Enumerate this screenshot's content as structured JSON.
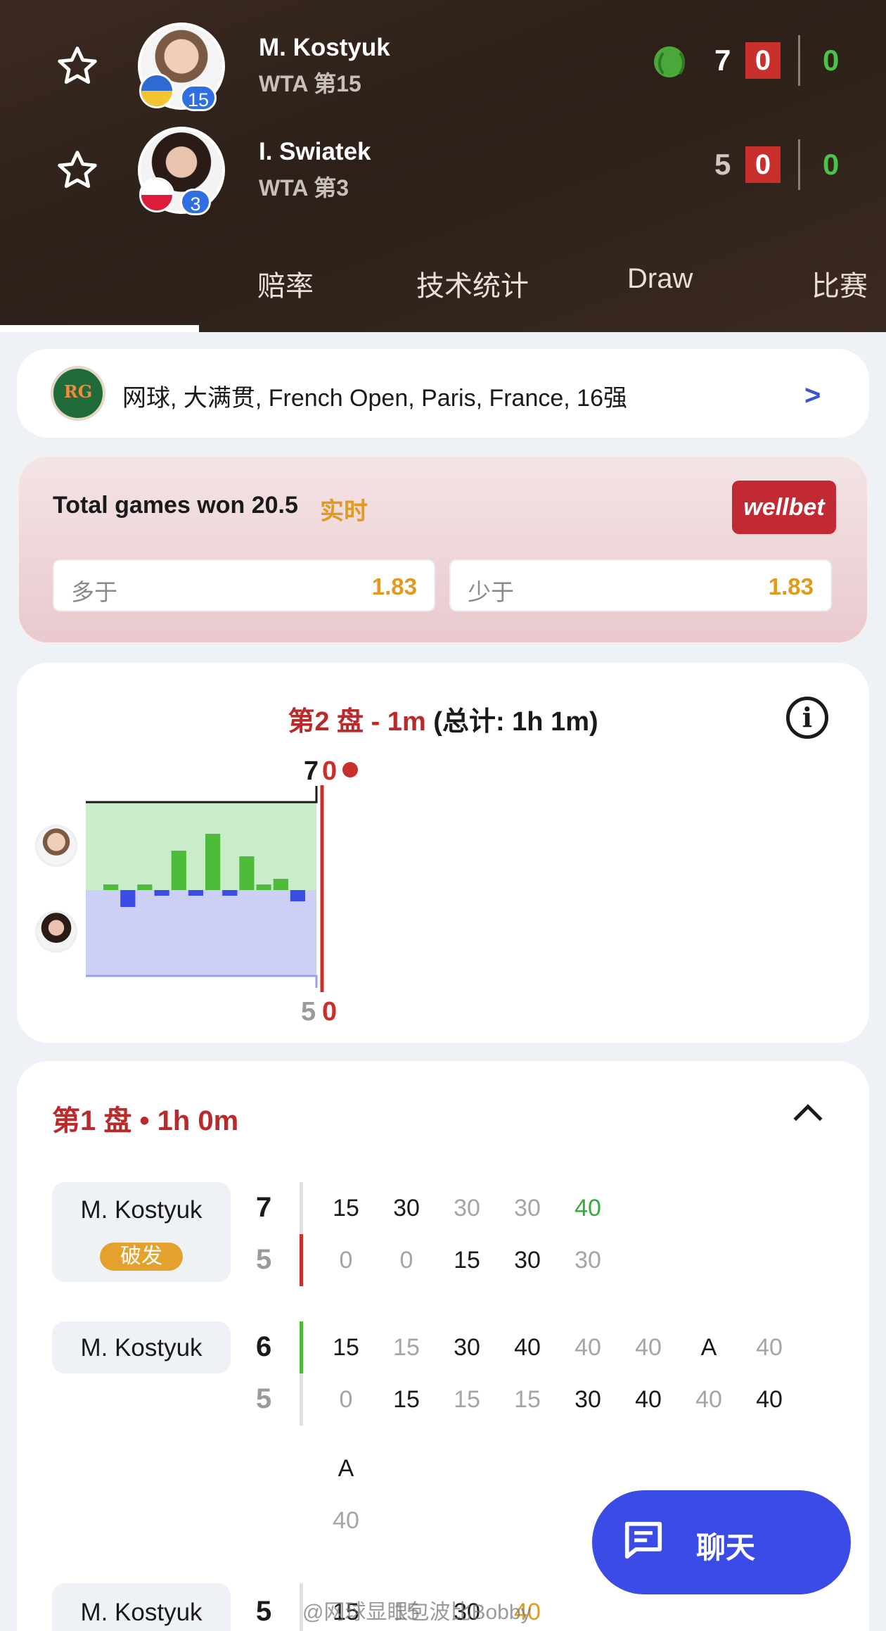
{
  "header": {
    "players": [
      {
        "name": "M. Kostyuk",
        "rank_text": "WTA 第15",
        "seed": "15",
        "set1": "7",
        "current_set": "0",
        "point": "0",
        "flag": [
          "#2e6ad1",
          "#f4c531"
        ],
        "serving": true
      },
      {
        "name": "I. Swiatek",
        "rank_text": "WTA 第3",
        "seed": "3",
        "set1": "5",
        "current_set": "0",
        "point": "0",
        "flag": [
          "#ffffff",
          "#dc1c3a"
        ],
        "serving": false
      }
    ],
    "tabs": [
      "赔率",
      "技术统计",
      "Draw",
      "比赛"
    ]
  },
  "tournament": {
    "text": "网球, 大满贯, French Open, Paris, France, 16强"
  },
  "betting": {
    "market": "Total games won 20.5",
    "live_label": "实时",
    "bookmaker": "wellbet",
    "over_label": "多于",
    "over_odds": "1.83",
    "under_label": "少于",
    "under_odds": "1.83"
  },
  "momentum": {
    "title_red": "第2 盘 - 1m",
    "title_rest": "(总计: 1h 1m)",
    "top_score": "7",
    "top_current": "0",
    "bottom_score": "5",
    "bottom_current": "0",
    "bars": [
      1,
      -3,
      1,
      -1,
      7,
      -1,
      10,
      -1,
      6,
      1,
      2,
      -2
    ],
    "colors": {
      "kostyuk": "#4dbb3a",
      "swiatek": "#3a4be6",
      "current": "#c9302c"
    }
  },
  "set1": {
    "title": "第1 盘 • 1h 0m",
    "games": [
      {
        "server": "M. Kostyuk",
        "badge": "破发",
        "top_score": "7",
        "bottom_score": "5",
        "top": [
          "15",
          "30",
          "30",
          "30",
          "40"
        ],
        "bottom": [
          "0",
          "0",
          "15",
          "30",
          "30"
        ]
      },
      {
        "server": "M. Kostyuk",
        "badge": "",
        "top_score": "6",
        "bottom_score": "5",
        "top": [
          "15",
          "15",
          "30",
          "40",
          "40",
          "40",
          "A",
          "40",
          "A"
        ],
        "bottom": [
          "0",
          "15",
          "15",
          "15",
          "30",
          "40",
          "40",
          "40",
          "40"
        ]
      },
      {
        "server": "M. Kostyuk",
        "badge": "",
        "top_score": "5",
        "bottom_score": "",
        "top": [
          "15",
          "15",
          "30",
          "40"
        ],
        "bottom": []
      }
    ]
  },
  "chat": {
    "label": "聊天"
  },
  "watermark": "@网球显眼包波比Bobby"
}
